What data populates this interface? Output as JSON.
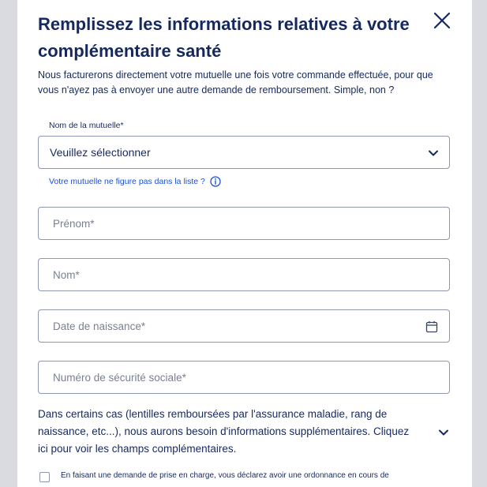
{
  "modal": {
    "title": "Remplissez les informations relatives à votre complémentaire santé",
    "subtitle": "Nous facturerons directement votre mutuelle une fois votre commande effectuée, pour que vous n'ayez pas à envoyer une autre demande de remboursement. Simple, non ?",
    "close_icon": "close-icon"
  },
  "mutuelle": {
    "label": "Nom de la mutuelle*",
    "value": "Veuillez sélectionner",
    "help_link": "Votre mutuelle ne figure pas dans la liste ?"
  },
  "fields": {
    "prenom": "Prénom*",
    "nom": "Nom*",
    "date_naissance": "Date de naissance*",
    "secu": "Numéro de sécurité sociale*"
  },
  "extra_info": "Dans certains cas (lentilles remboursées par l'assurance maladie, rang de naissance, etc...), nous aurons besoin d'informations supplémentaires. Cliquez ici pour voir les champs complémentaires.",
  "consent": "En faisant une demande de prise en charge, vous déclarez avoir une ordonnance en cours de",
  "colors": {
    "title": "#16295e",
    "link": "#1e4fd1",
    "border": "#8e97ad",
    "placeholder": "#7a8092"
  }
}
